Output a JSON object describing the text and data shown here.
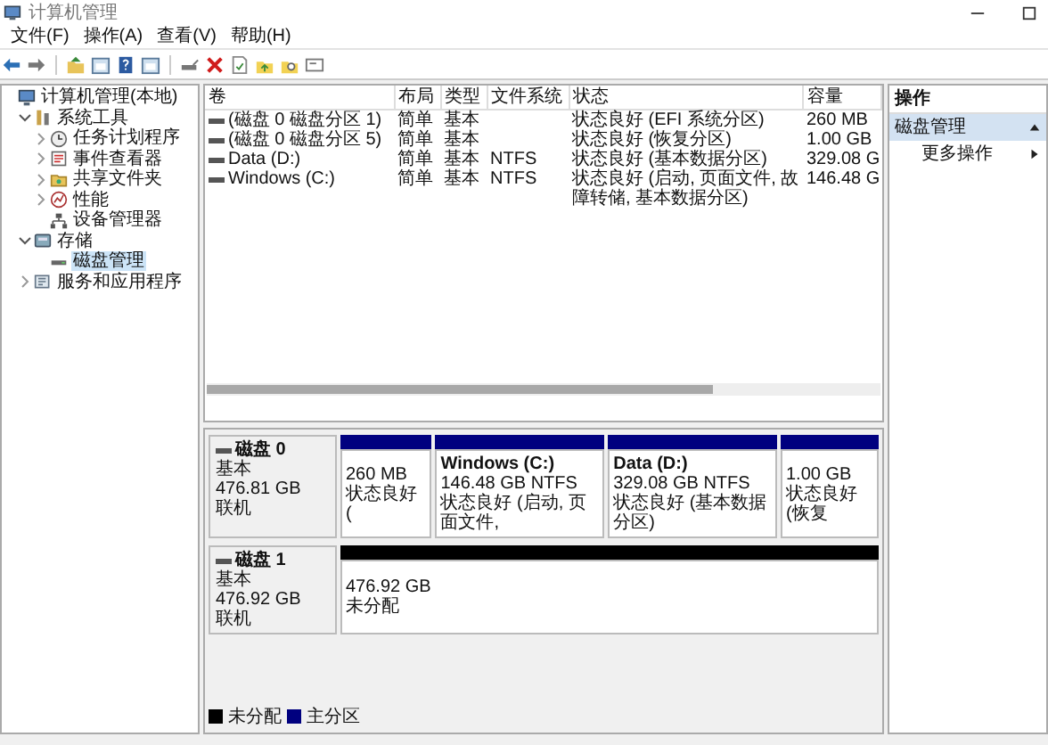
{
  "window": {
    "title": "计算机管理"
  },
  "menu": [
    "文件(F)",
    "操作(A)",
    "查看(V)",
    "帮助(H)"
  ],
  "tree": [
    {
      "label": "计算机管理(本地)",
      "kind": "computer",
      "selected": false,
      "children": [
        {
          "label": "系统工具",
          "kind": "tools",
          "expanded": true,
          "selected": false,
          "children": [
            {
              "label": "任务计划程序",
              "kind": "clock",
              "expanded": false,
              "selected": false
            },
            {
              "label": "事件查看器",
              "kind": "event",
              "expanded": false,
              "selected": false
            },
            {
              "label": "共享文件夹",
              "kind": "share",
              "expanded": false,
              "selected": false
            },
            {
              "label": "性能",
              "kind": "perf",
              "expanded": false,
              "selected": false
            },
            {
              "label": "设备管理器",
              "kind": "device",
              "selected": false
            }
          ]
        },
        {
          "label": "存储",
          "kind": "storage",
          "expanded": true,
          "selected": false,
          "children": [
            {
              "label": "磁盘管理",
              "kind": "disk",
              "selected": true
            }
          ]
        },
        {
          "label": "服务和应用程序",
          "kind": "services",
          "expanded": false,
          "selected": false
        }
      ]
    }
  ],
  "volumes": {
    "columns": [
      "卷",
      "布局",
      "类型",
      "文件系统",
      "状态",
      "容量"
    ],
    "rows": [
      [
        "(磁盘 0 磁盘分区 1)",
        "简单",
        "基本",
        "",
        "状态良好 (EFI 系统分区)",
        "260 MB"
      ],
      [
        "(磁盘 0 磁盘分区 5)",
        "简单",
        "基本",
        "",
        "状态良好 (恢复分区)",
        "1.00 GB"
      ],
      [
        "Data (D:)",
        "简单",
        "基本",
        "NTFS",
        "状态良好 (基本数据分区)",
        "329.08 G"
      ],
      [
        "Windows (C:)",
        "简单",
        "基本",
        "NTFS",
        "状态良好 (启动, 页面文件, 故障转储, 基本数据分区)",
        "146.48 G"
      ]
    ]
  },
  "disks": [
    {
      "name": "磁盘 0",
      "type": "基本",
      "size": "476.81 GB",
      "status": "联机",
      "partitions": [
        {
          "size": "260 MB",
          "status": "状态良好 (",
          "color": "#00007f"
        },
        {
          "title": "Windows  (C:)",
          "size": "146.48 GB NTFS",
          "status": "状态良好 (启动, 页面文件,",
          "color": "#00007f"
        },
        {
          "title": "Data  (D:)",
          "size": "329.08 GB NTFS",
          "status": "状态良好 (基本数据分区)",
          "color": "#00007f"
        },
        {
          "size": "1.00 GB",
          "status": "状态良好 (恢复",
          "color": "#00007f"
        }
      ]
    },
    {
      "name": "磁盘 1",
      "type": "基本",
      "size": "476.92 GB",
      "status": "联机",
      "partitions": [
        {
          "size": "476.92 GB",
          "status": "未分配",
          "color": "#000000"
        }
      ]
    }
  ],
  "legend": [
    {
      "label": "未分配",
      "color": "#000000"
    },
    {
      "label": "主分区",
      "color": "#00007f"
    }
  ],
  "actions": {
    "title": "操作",
    "section": "磁盘管理",
    "items": [
      "更多操作"
    ]
  }
}
